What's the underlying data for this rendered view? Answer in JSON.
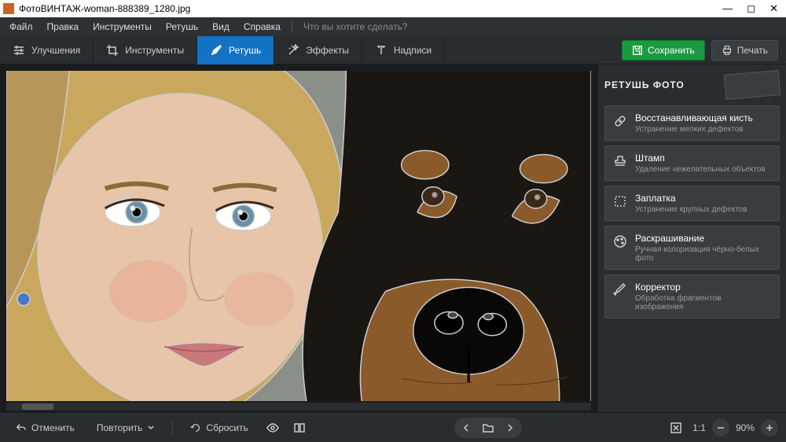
{
  "window": {
    "app_name": "ФотоВИНТАЖ",
    "file_name": "woman-888389_1280.jpg",
    "title_sep": " - "
  },
  "menu": {
    "file": "Файл",
    "edit": "Правка",
    "tools": "Инструменты",
    "retouch": "Ретушь",
    "view": "Вид",
    "help": "Справка",
    "search_placeholder": "Что вы хотите сделать?"
  },
  "tabs": {
    "enhance": "Улучшения",
    "tools": "Инструменты",
    "retouch": "Ретушь",
    "effects": "Эффекты",
    "text": "Надписи"
  },
  "actions": {
    "save": "Сохранить",
    "print": "Печать"
  },
  "panel": {
    "title": "РЕТУШЬ ФОТО",
    "tools": [
      {
        "name": "Восстанавливающая кисть",
        "desc": "Устранение мелких дефектов"
      },
      {
        "name": "Штамп",
        "desc": "Удаление нежелательных объектов"
      },
      {
        "name": "Заплатка",
        "desc": "Устранение крупных дефектов"
      },
      {
        "name": "Раскрашивание",
        "desc": "Ручная колоризация чёрно-белых фото"
      },
      {
        "name": "Корректор",
        "desc": "Обработка фрагментов изображения"
      }
    ]
  },
  "bottom": {
    "undo": "Отменить",
    "redo": "Повторить",
    "reset": "Сбросить",
    "zoom_ratio": "1:1",
    "zoom_percent": "90%"
  }
}
